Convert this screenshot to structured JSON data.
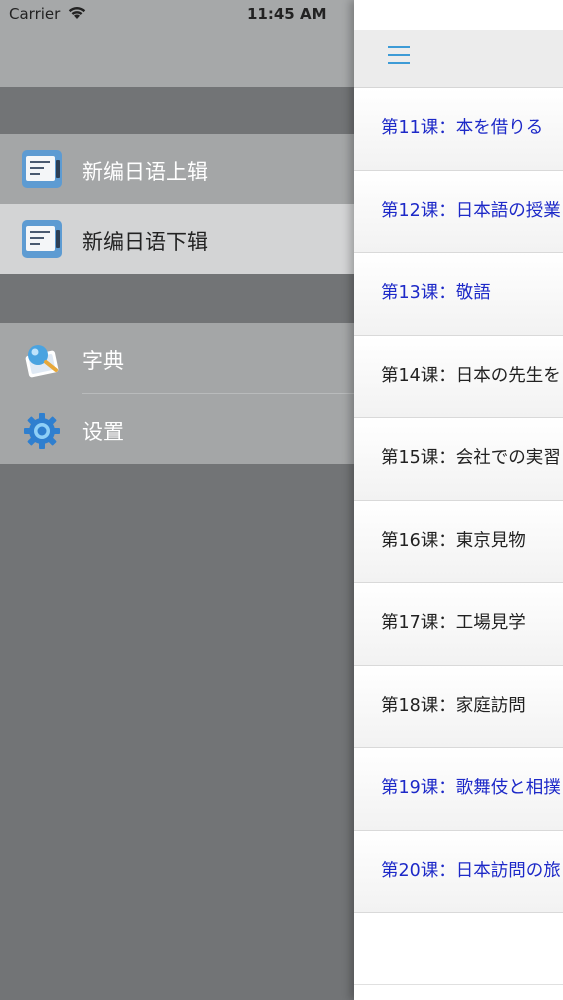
{
  "status_bar": {
    "carrier": "Carrier",
    "time": "11:45 AM"
  },
  "drawer": {
    "books": [
      {
        "label": "新编日语上辑",
        "selected": false
      },
      {
        "label": "新编日语下辑",
        "selected": true
      }
    ],
    "tools": [
      {
        "label": "字典",
        "icon": "dictionary-icon"
      },
      {
        "label": "设置",
        "icon": "gear-icon"
      }
    ]
  },
  "lessons": [
    {
      "title": "第11课：本を借りる",
      "highlight": true
    },
    {
      "title": "第12课：日本語の授業",
      "highlight": true
    },
    {
      "title": "第13课：敬語",
      "highlight": true
    },
    {
      "title": "第14课：日本の先生を",
      "highlight": false
    },
    {
      "title": "第15课：会社での実習",
      "highlight": false
    },
    {
      "title": "第16课：東京見物",
      "highlight": false
    },
    {
      "title": "第17课：工場見学",
      "highlight": false
    },
    {
      "title": "第18课：家庭訪問",
      "highlight": false
    },
    {
      "title": "第19课：歌舞伎と相撲",
      "highlight": true
    },
    {
      "title": "第20课：日本訪問の旅",
      "highlight": true
    }
  ],
  "colors": {
    "drawer_bg": "#727476",
    "menu_item_bg": "#a4a6a7",
    "menu_selected_bg": "#d3d4d5",
    "lesson_highlight": "#1d29c8",
    "accent": "#3d9bd6"
  }
}
